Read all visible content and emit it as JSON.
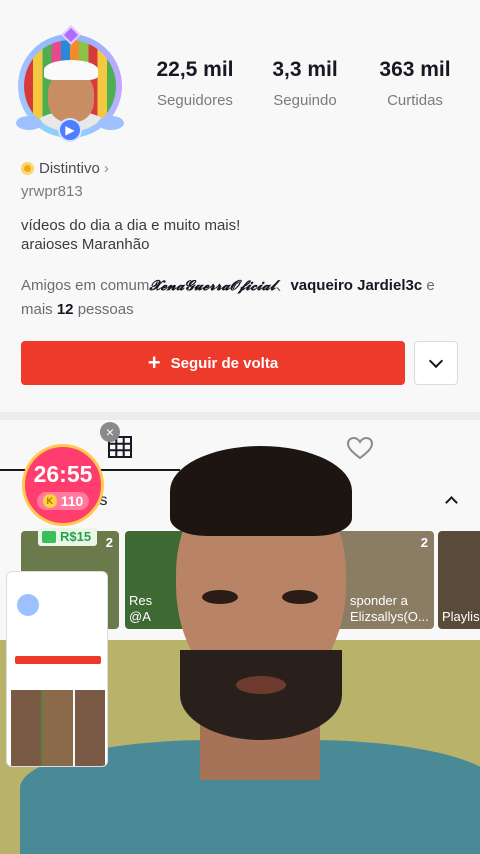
{
  "profile": {
    "stats": [
      {
        "value": "22,5 mil",
        "label": "Seguidores"
      },
      {
        "value": "3,3 mil",
        "label": "Seguindo"
      },
      {
        "value": "363 mil",
        "label": "Curtidas"
      }
    ],
    "badge_label": "Distintivo",
    "username": "yrwpr813",
    "bio_line1": "vídeos do dia a dia e muito mais!",
    "bio_line2": "araioses Maranhão",
    "friends_prefix": "Amigos em comum",
    "friend1": "𝓧𝓮𝓷𝓪𝓖𝓾𝓮𝓻𝓻𝓪𝓞𝓯𝓲𝓬𝓲𝓪𝓵",
    "friend_sep": "、",
    "friend2": "vaqueiro Jardiel3c",
    "friends_and": " e",
    "friends_more_prefix": "mais ",
    "friends_more_count": "12",
    "friends_more_suffix": " pessoas"
  },
  "actions": {
    "follow_back_label": "Seguir de volta"
  },
  "playlists": {
    "title": "lists",
    "cards": [
      {
        "count": "2",
        "caption": "",
        "color": "#6a7a4a"
      },
      {
        "count": "",
        "caption": "Res\n@A",
        "color": "#3d6a32"
      },
      {
        "count": "2",
        "caption": "sponder a\nElizsallys(O...",
        "color": "#8a7d64"
      },
      {
        "count": "",
        "caption": "Playlis",
        "color": "#5a4a3a"
      }
    ]
  },
  "overlay": {
    "timer": "26:55",
    "coins": "110",
    "coin_symbol": "K",
    "reward": "R$15",
    "close_symbol": "×"
  },
  "colors": {
    "accent": "#ee3a2a",
    "timer_bg": "#ff3d6e",
    "reward_green": "#24a148"
  }
}
